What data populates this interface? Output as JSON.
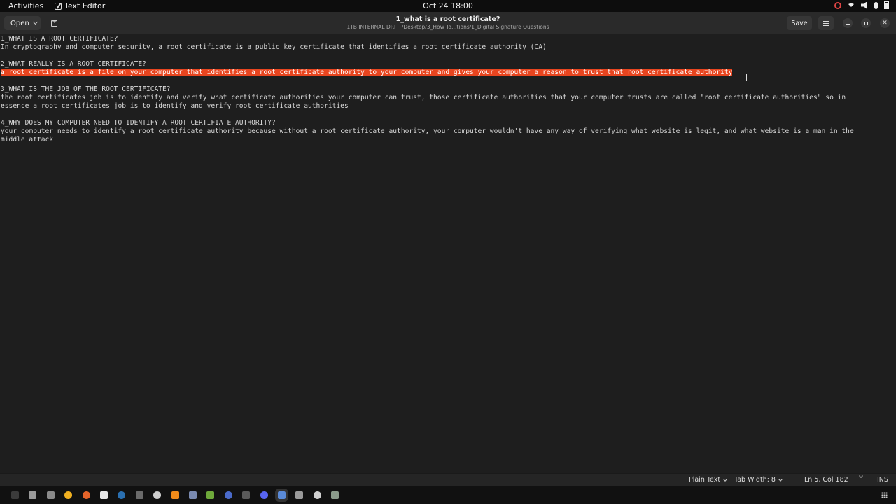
{
  "topbar": {
    "activities": "Activities",
    "app_name": "Text Editor",
    "clock": "Oct 24  18:00"
  },
  "headerbar": {
    "open_label": "Open",
    "title": "1_what is a root certificate?",
    "subtitle": "1TB INTERNAL DRI ~/Desktop/3_How To…tions/1_Digital Signature Questions",
    "save_label": "Save"
  },
  "document": {
    "lines": [
      "1_WHAT IS A ROOT CERTIFICATE?",
      "In cryptography and computer security, a root certificate is a public key certificate that identifies a root certificate authority (CA)",
      "",
      "2_WHAT REALLY IS A ROOT CERTIFICATE?",
      "a root certificate is a file on your computer that identifies a root certificate authority to your computer and gives your computer a reason to trust that root certificate authority",
      "",
      "3_WHAT IS THE JOB OF THE ROOT CERTIFICATE?",
      "the root certificates job is to identify and verify what certificate authorities your computer can trust, those certificate authorities that your computer trusts are called \"root certificate authorities\" so in",
      "essence a root certificates job is to identify and verify root certificate authorities",
      "",
      "4_WHY DOES MY COMPUTER NEED TO IDENTIFY A ROOT CERTIFIATE AUTHORITY?",
      "your computer needs to identify a root certificate authority because without a root certificate authority, your computer wouldn't have any way of verifying what website is legit, and what website is a man in the",
      "middle attack"
    ],
    "selected_line": 4
  },
  "statusbar": {
    "language": "Plain Text",
    "tab_width": "Tab Width: 8",
    "position": "Ln 5, Col 182",
    "mode": "INS"
  },
  "taskbar": {
    "icons": [
      {
        "name": "terminal-icon",
        "color": "#3b3b3b"
      },
      {
        "name": "text-files-icon",
        "color": "#9a9a9a"
      },
      {
        "name": "files-icon",
        "color": "#8a8a8a"
      },
      {
        "name": "chrome-icon",
        "color": "#f0b020"
      },
      {
        "name": "firefox-icon",
        "color": "#e5642a"
      },
      {
        "name": "app-hex-icon",
        "color": "#e8e8e8"
      },
      {
        "name": "steam-icon",
        "color": "#2a6fb0"
      },
      {
        "name": "app-gray-icon",
        "color": "#6a6a6a"
      },
      {
        "name": "app-circle-icon",
        "color": "#cfcfcf"
      },
      {
        "name": "vlc-icon",
        "color": "#f08a1a"
      },
      {
        "name": "app-bird-icon",
        "color": "#7a8ab0"
      },
      {
        "name": "app-green-icon",
        "color": "#6ea83a"
      },
      {
        "name": "app-blue-circle-icon",
        "color": "#4a6aca"
      },
      {
        "name": "app-window-icon",
        "color": "#5a5a5a"
      },
      {
        "name": "chat-icon",
        "color": "#5865f2"
      },
      {
        "name": "text-editor-icon",
        "color": "#5a8ad8"
      },
      {
        "name": "document-icon",
        "color": "#9a9a9a"
      },
      {
        "name": "disc-icon",
        "color": "#d0d0d0"
      },
      {
        "name": "notes-icon",
        "color": "#8a9a8a"
      }
    ]
  }
}
